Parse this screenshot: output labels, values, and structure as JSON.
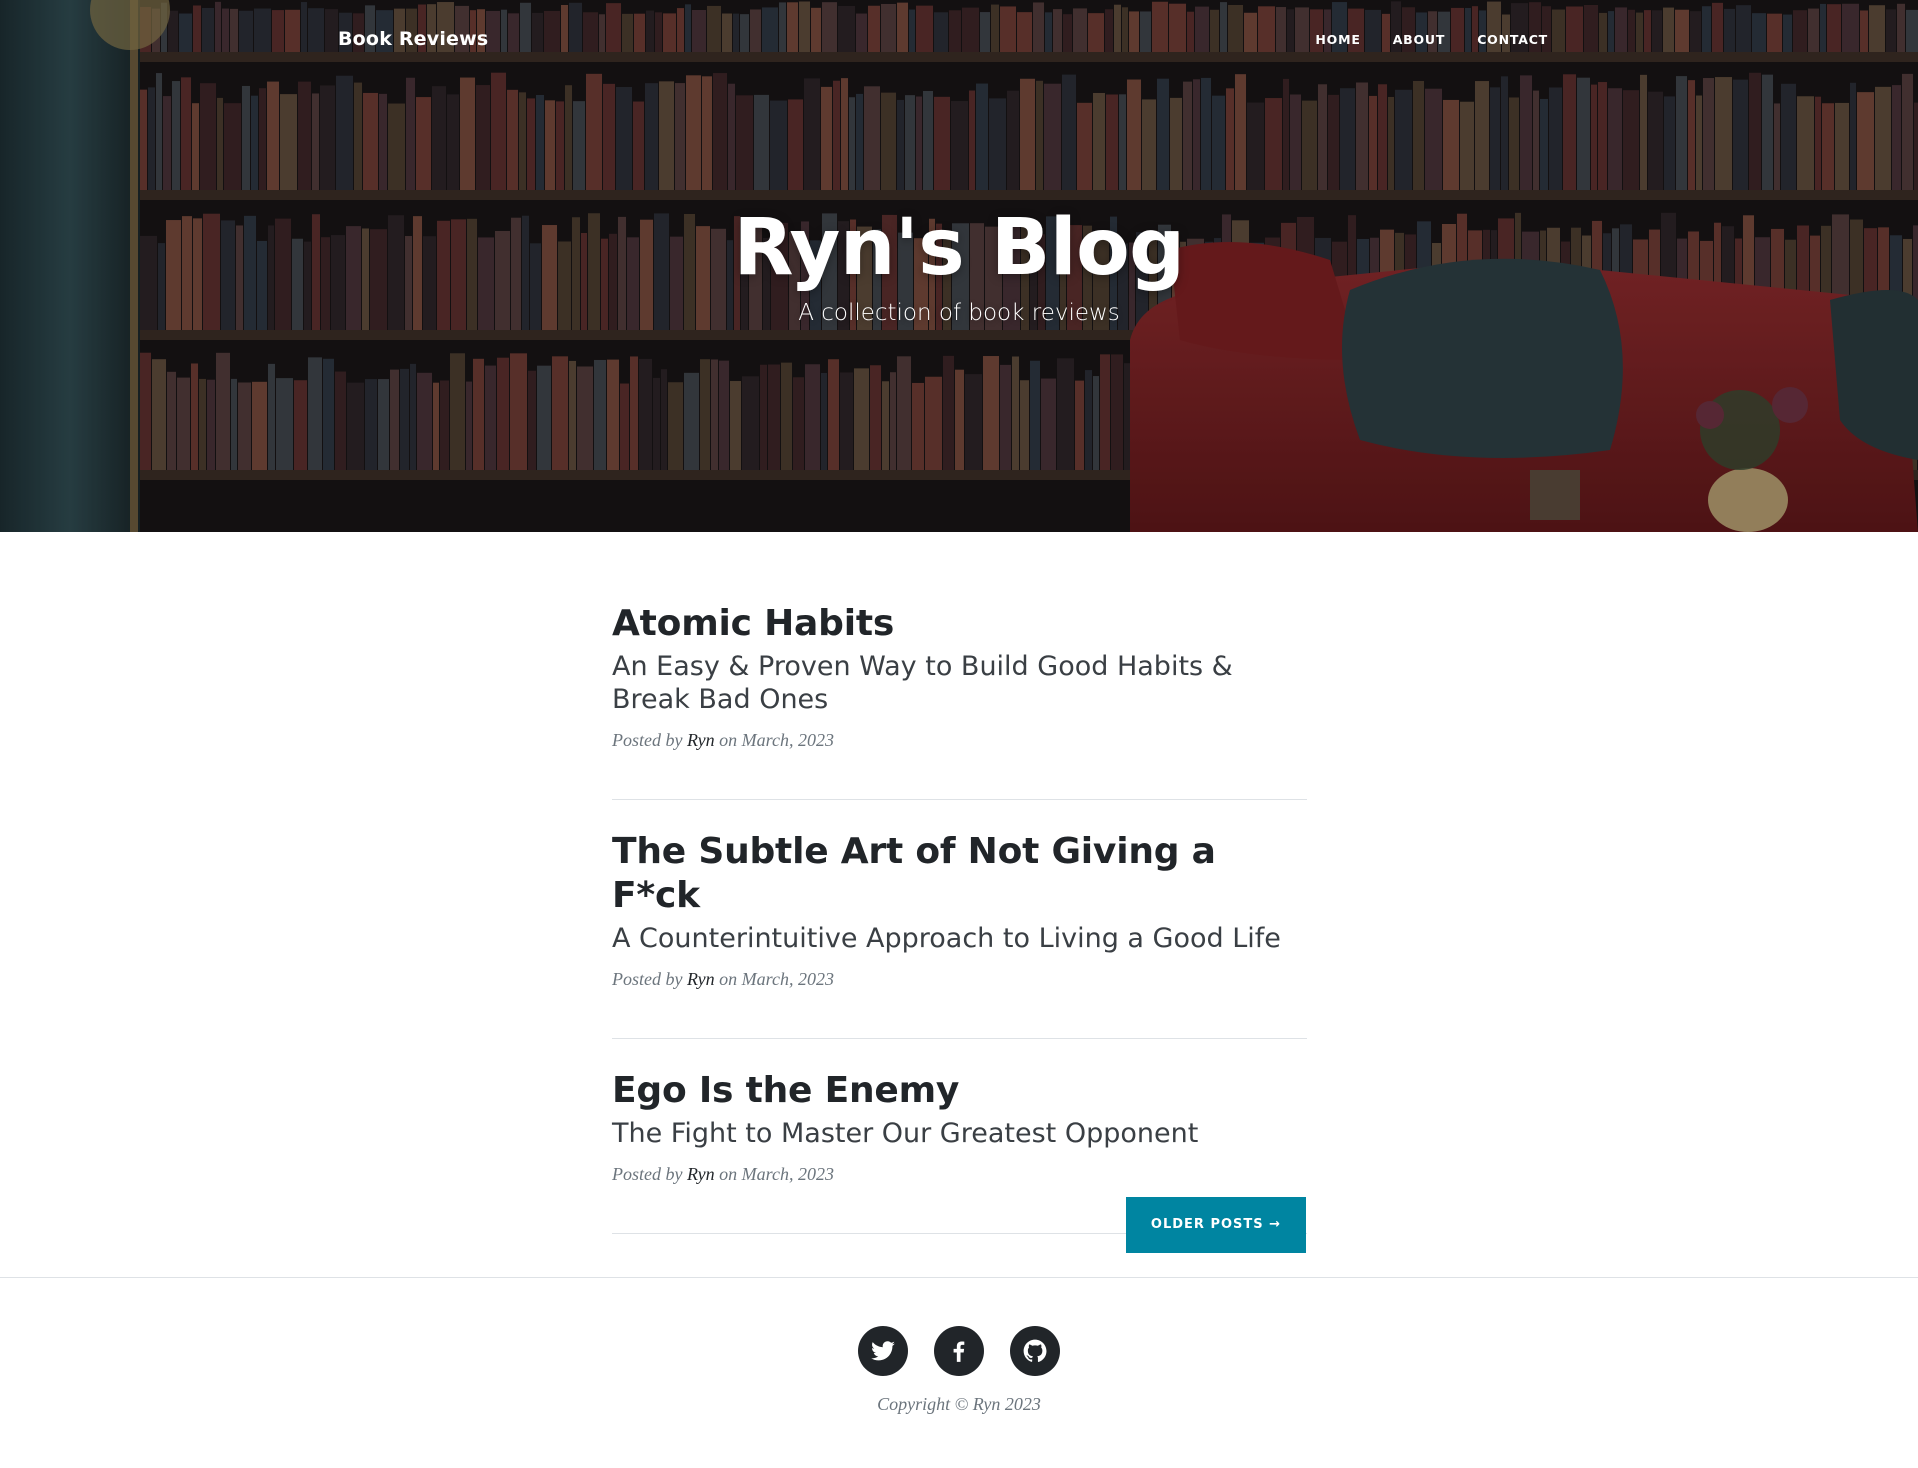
{
  "navbar": {
    "brand": "Book Reviews",
    "links": [
      "HOME",
      "ABOUT",
      "CONTACT"
    ]
  },
  "hero": {
    "title": "Ryn's Blog",
    "subtitle": "A collection of book reviews"
  },
  "posts": [
    {
      "title": "Atomic Habits",
      "subtitle": "An Easy & Proven Way to Build Good Habits & Break Bad Ones",
      "meta_prefix": "Posted by",
      "author": "Ryn",
      "meta_suffix": "on March, 2023"
    },
    {
      "title": "The Subtle Art of Not Giving a F*ck",
      "subtitle": "A Counterintuitive Approach to Living a Good Life",
      "meta_prefix": "Posted by",
      "author": "Ryn",
      "meta_suffix": "on March, 2023"
    },
    {
      "title": "Ego Is the Enemy",
      "subtitle": "The Fight to Master Our Greatest Opponent",
      "meta_prefix": "Posted by",
      "author": "Ryn",
      "meta_suffix": "on March, 2023"
    }
  ],
  "pager": {
    "older_label": "OLDER POSTS →"
  },
  "footer": {
    "social": [
      "twitter-icon",
      "facebook-icon",
      "github-icon"
    ],
    "copyright": "Copyright © Ryn 2023"
  },
  "colors": {
    "accent": "#0085a1",
    "text": "#212529",
    "muted": "#6c757d"
  }
}
